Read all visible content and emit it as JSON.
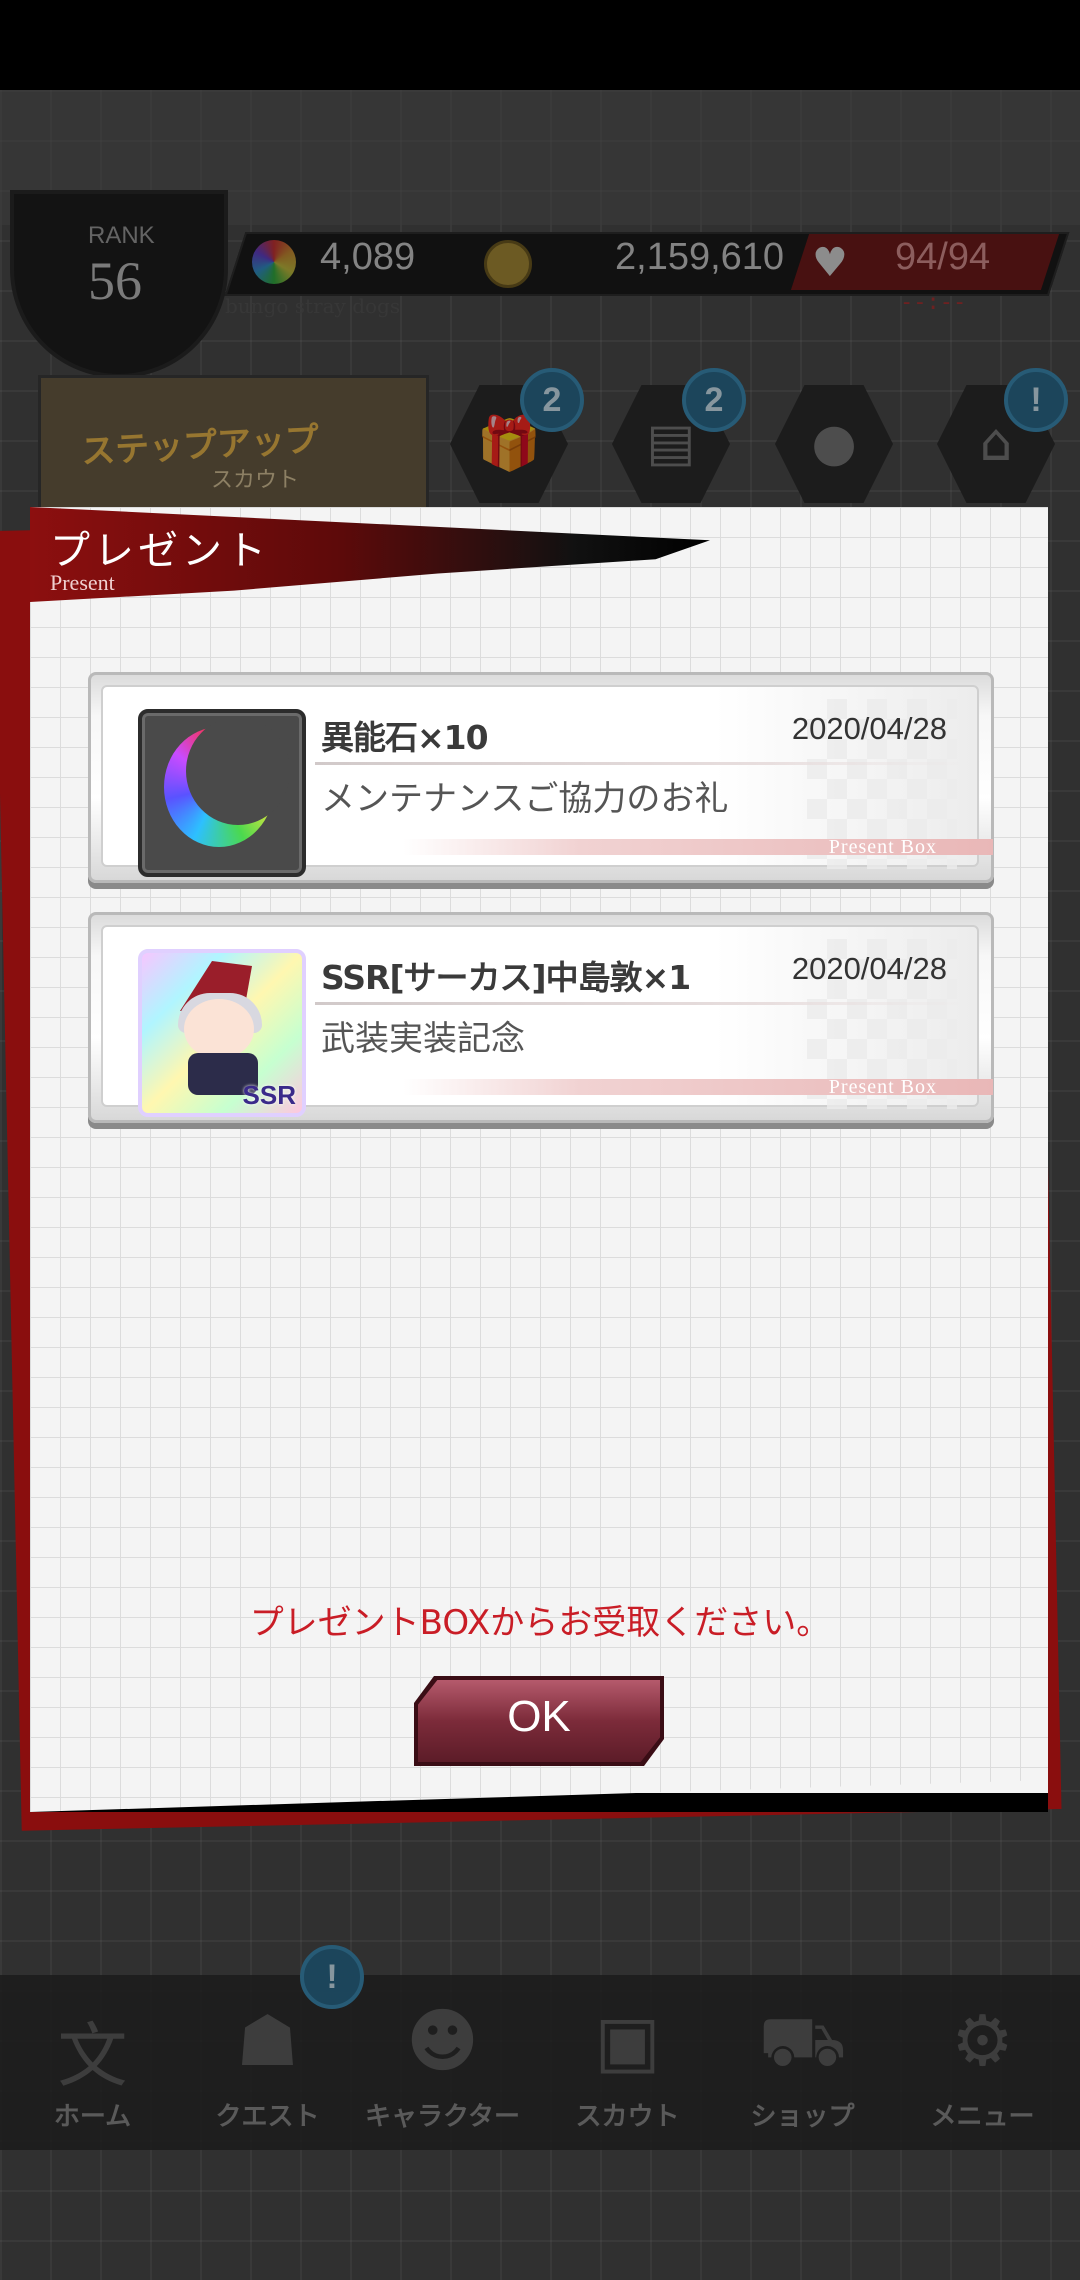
{
  "hud": {
    "rank_label": "RANK",
    "rank_value": "56",
    "gems": "4,089",
    "coins": "2,159,610",
    "stamina": "94/94",
    "stamina_timer": "--:--",
    "subtitle": "bungo stray dogs"
  },
  "banner": {
    "title": "ステップアップ",
    "subtitle": "スカウト"
  },
  "hud_icons": [
    {
      "name": "gift-icon",
      "badge": "2"
    },
    {
      "name": "news-icon",
      "badge": "2"
    },
    {
      "name": "magnifier-icon",
      "badge": ""
    },
    {
      "name": "building-icon",
      "badge": "!"
    }
  ],
  "modal": {
    "title": "プレゼント",
    "subtitle": "Present",
    "items": [
      {
        "name": "異能石×10",
        "date": "2020/04/28",
        "description": "メンテナンスご協力のお礼",
        "footer": "Present Box",
        "icon": "rainbow-moon-icon"
      },
      {
        "name": "SSR[サーカス]中島敦×1",
        "date": "2020/04/28",
        "description": "武装実装記念",
        "footer": "Present Box",
        "icon": "character-card-icon",
        "rarity": "SSR"
      }
    ],
    "notice": "プレゼントBOXからお受取ください。",
    "ok_label": "OK"
  },
  "nav": [
    {
      "label": "ホーム",
      "icon": "home-icon"
    },
    {
      "label": "クエスト",
      "icon": "quest-icon",
      "badge": "!"
    },
    {
      "label": "キャラクター",
      "icon": "character-icon"
    },
    {
      "label": "スカウト",
      "icon": "scout-icon"
    },
    {
      "label": "ショップ",
      "icon": "shop-icon"
    },
    {
      "label": "メニュー",
      "icon": "menu-icon"
    }
  ],
  "colors": {
    "accent": "#c91d26",
    "header_red": "#8c0f0f",
    "ok_button": "#7c2b3a"
  }
}
